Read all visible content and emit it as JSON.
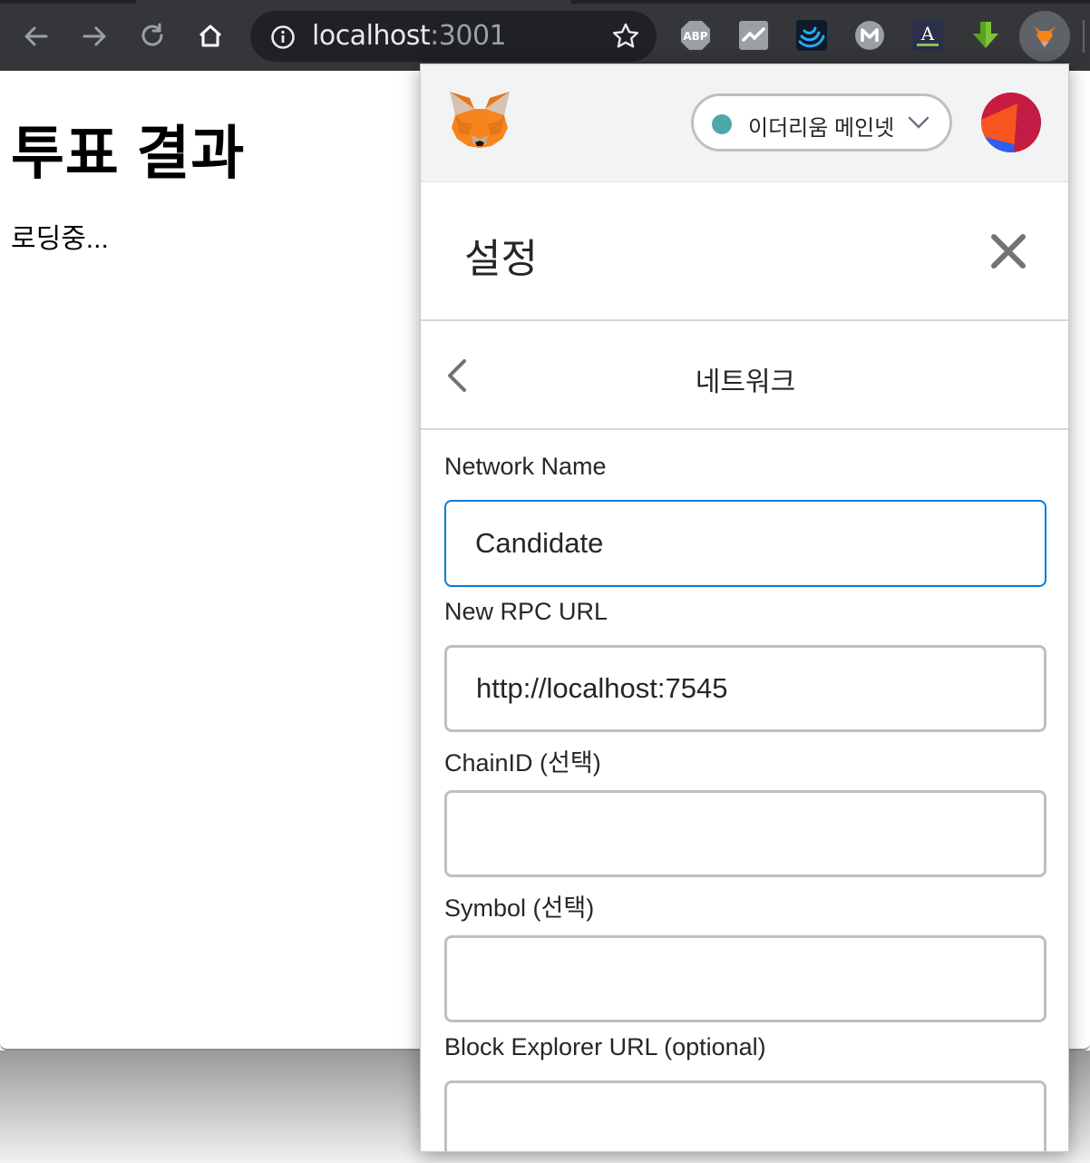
{
  "browser": {
    "url_host": "localhost",
    "url_port": ":3001",
    "extensions": [
      "abp-icon",
      "chart-extension-icon",
      "wave-extension-icon",
      "m-extension-icon",
      "font-extension-icon",
      "download-arrow-icon",
      "metamask-fox-icon"
    ],
    "extension_labels": {
      "abp": "ABP"
    }
  },
  "page": {
    "title": "투표 결과",
    "status": "로딩중..."
  },
  "metamask": {
    "network": {
      "label": "이더리움 메인넷",
      "status_color": "#4ea7a8"
    },
    "settings_title": "설정",
    "section_title": "네트워크",
    "fields": [
      {
        "label": "Network Name",
        "value": "Candidate",
        "placeholder": ""
      },
      {
        "label": "New RPC URL",
        "value": "http://localhost:7545",
        "placeholder": ""
      },
      {
        "label": "ChainID (선택)",
        "value": "",
        "placeholder": ""
      },
      {
        "label": "Symbol (선택)",
        "value": "",
        "placeholder": ""
      },
      {
        "label": "Block Explorer URL (optional)",
        "value": "",
        "placeholder": ""
      }
    ],
    "colors": {
      "accent": "#037dd6",
      "border": "#bbc0c5",
      "header_bg": "#f2f3f4"
    }
  }
}
